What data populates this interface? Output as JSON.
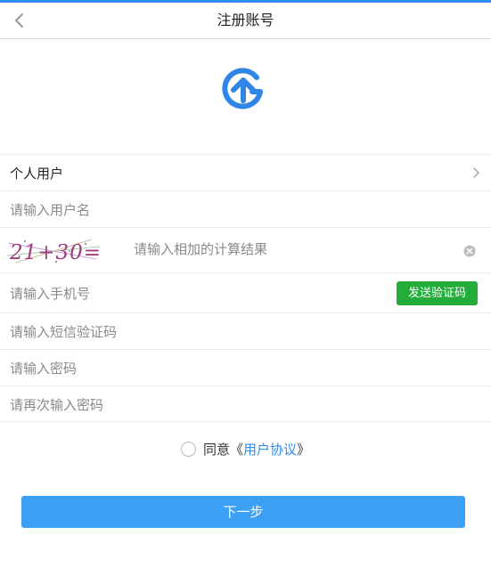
{
  "header": {
    "title": "注册账号",
    "back_icon": "chevron-left-icon"
  },
  "logo": {
    "icon": "house-logo-icon",
    "color": "#2f86e6"
  },
  "form": {
    "user_type": {
      "value": "个人用户",
      "icon": "chevron-right-icon"
    },
    "username": {
      "placeholder": "请输入用户名"
    },
    "captcha": {
      "image_text": "21+30=",
      "placeholder": "请输入相加的计算结果",
      "clear_icon": "clear-circle-icon"
    },
    "phone": {
      "placeholder": "请输入手机号",
      "send_code_label": "发送验证码",
      "send_code_color": "#22ac38"
    },
    "sms_code": {
      "placeholder": "请输入短信验证码"
    },
    "password": {
      "placeholder": "请输入密码"
    },
    "password_confirm": {
      "placeholder": "请再次输入密码"
    }
  },
  "agreement": {
    "prefix": "同意《",
    "link": "用户协议",
    "suffix": "》",
    "checked": false
  },
  "actions": {
    "next_label": "下一步",
    "next_color": "#3ca0f5"
  },
  "colors": {
    "accent": "#2f8cf0"
  }
}
